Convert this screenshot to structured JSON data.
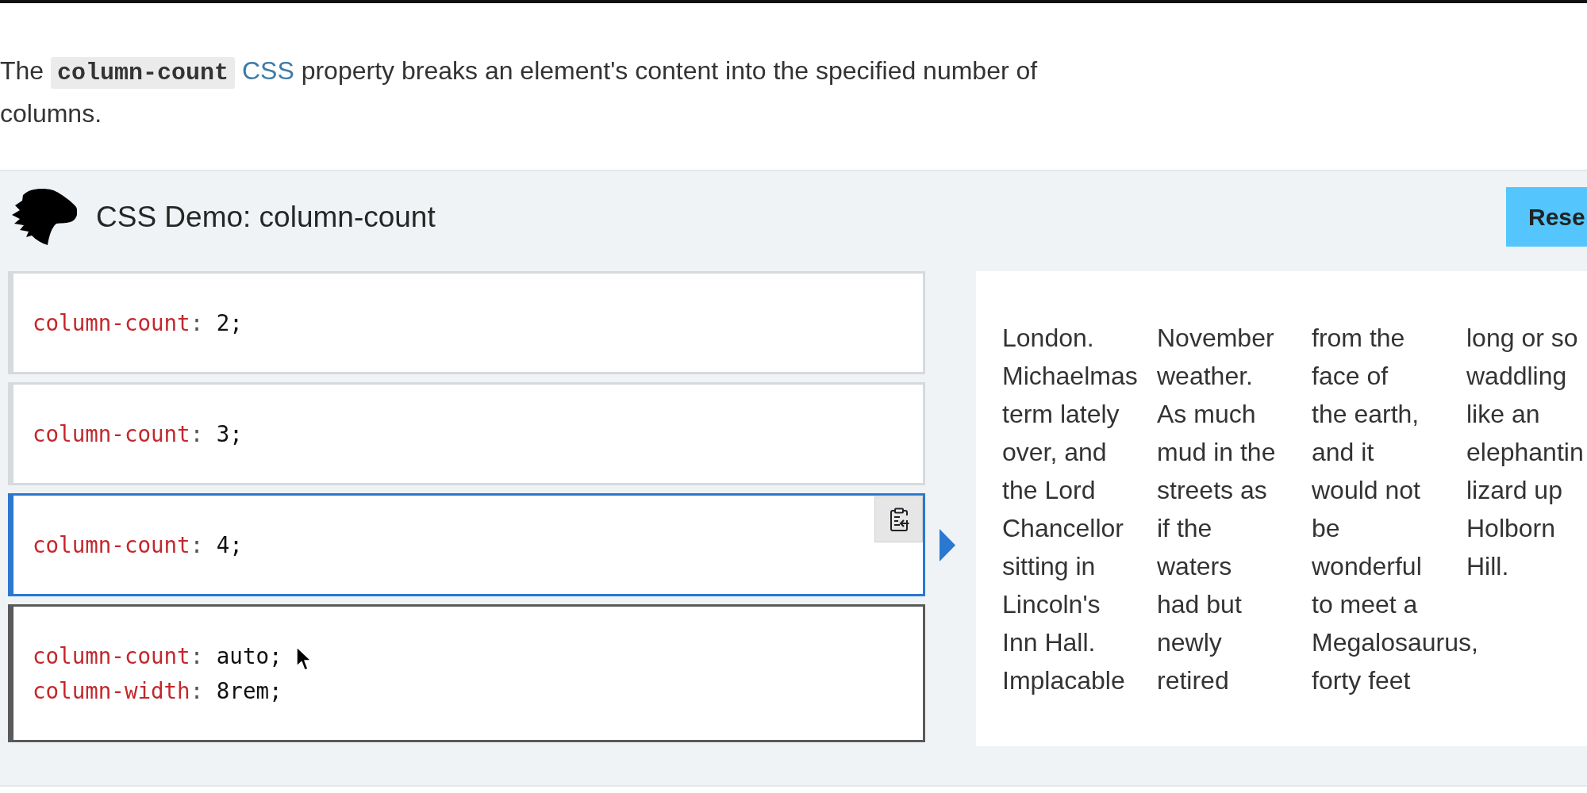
{
  "intro": {
    "parts": [
      {
        "kind": "text",
        "text": "The "
      },
      {
        "kind": "code",
        "text": "column-count"
      },
      {
        "kind": "link",
        "text": "CSS"
      },
      {
        "kind": "text",
        "text": " property breaks an element's content into the specified number of columns."
      }
    ]
  },
  "demo": {
    "title": "CSS Demo: column-count",
    "reset_button": {
      "label": "Rese"
    },
    "editors": [
      {
        "selected": false,
        "hovered": false,
        "lines": [
          [
            {
              "kind": "property",
              "text": "column-count"
            },
            {
              "kind": "punctuation",
              "text": ": "
            },
            {
              "kind": "value",
              "text": "2;"
            }
          ]
        ]
      },
      {
        "selected": false,
        "hovered": false,
        "lines": [
          [
            {
              "kind": "property",
              "text": "column-count"
            },
            {
              "kind": "punctuation",
              "text": ": "
            },
            {
              "kind": "value",
              "text": "3;"
            }
          ]
        ]
      },
      {
        "selected": true,
        "hovered": false,
        "lines": [
          [
            {
              "kind": "property",
              "text": "column-count"
            },
            {
              "kind": "punctuation",
              "text": ": "
            },
            {
              "kind": "value",
              "text": "4;"
            }
          ]
        ]
      },
      {
        "selected": false,
        "hovered": true,
        "lines": [
          [
            {
              "kind": "property",
              "text": "column-count"
            },
            {
              "kind": "punctuation",
              "text": ": "
            },
            {
              "kind": "value",
              "text": "auto;"
            }
          ],
          [
            {
              "kind": "property",
              "text": "column-width"
            },
            {
              "kind": "punctuation",
              "text": ": "
            },
            {
              "kind": "value",
              "text": "8rem;"
            }
          ]
        ]
      }
    ],
    "output": {
      "columns": [
        [
          "London.",
          "Michaelmas",
          "term lately",
          "over, and",
          "the Lord",
          "Chancellor",
          "sitting in",
          "Lincoln's",
          "Inn Hall.",
          "Implacable"
        ],
        [
          "November",
          "weather.",
          "As much",
          "mud in the",
          "streets as",
          "if the",
          "waters",
          "had but",
          "newly",
          "retired"
        ],
        [
          "from the",
          "face of",
          "the earth,",
          "and it",
          "would not",
          "be",
          "wonderful",
          "to meet a",
          "Megalosaurus,",
          "forty feet"
        ],
        [
          "long or so",
          "waddling",
          "like an",
          "elephantin",
          "lizard up",
          "Holborn",
          "Hill."
        ]
      ]
    }
  }
}
